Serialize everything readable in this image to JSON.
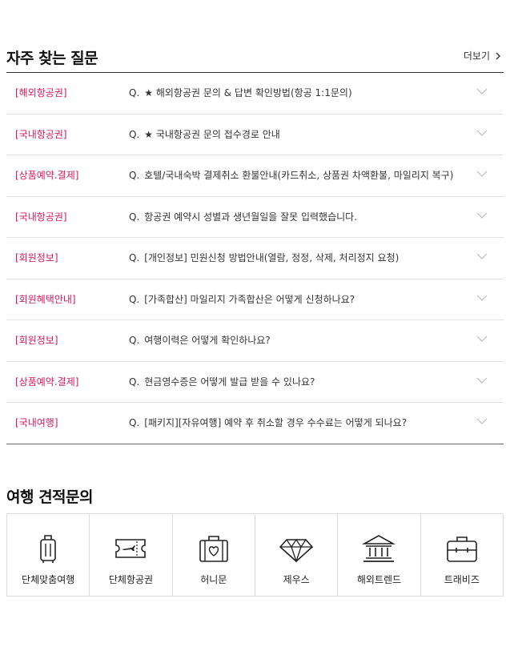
{
  "faq": {
    "title": "자주 찾는 질문",
    "more_label": "더보기",
    "q_prefix": "Q.",
    "items": [
      {
        "category": "[해외항공권]",
        "question": "★ 해외항공권 문의 & 답변 확인방법(항공 1:1문의)"
      },
      {
        "category": "[국내항공권]",
        "question": "★ 국내항공권 문의 접수경로 안내"
      },
      {
        "category": "[상품예약.결제]",
        "question": "호텔/국내숙박 결제취소 환불안내(카드취소, 상품권 차액환불, 마일리지 복구)"
      },
      {
        "category": "[국내항공권]",
        "question": "항공권 예약시 성별과 생년월일을 잘못 입력했습니다."
      },
      {
        "category": "[회원정보]",
        "question": "[개인정보] 민원신청 방법안내(열람, 정정, 삭제, 처리정지 요청)"
      },
      {
        "category": "[회원혜택안내]",
        "question": "[가족합산] 마일리지 가족합산은 어떻게 신청하나요?"
      },
      {
        "category": "[회원정보]",
        "question": "여행이력은 어떻게 확인하나요?"
      },
      {
        "category": "[상품예약.결제]",
        "question": "현금영수증은 어떻게 발급 받을 수 있나요?"
      },
      {
        "category": "[국내여행]",
        "question": "[패키지][자유여행] 예약 후 취소할 경우 수수료는 어떻게 되나요?"
      }
    ]
  },
  "quote": {
    "title": "여행 견적문의",
    "items": [
      {
        "label": "단체맞춤여행",
        "icon": "luggage-icon"
      },
      {
        "label": "단체항공권",
        "icon": "flight-ticket-icon"
      },
      {
        "label": "허니문",
        "icon": "heart-suitcase-icon"
      },
      {
        "label": "제우스",
        "icon": "diamond-icon"
      },
      {
        "label": "해외트렌드",
        "icon": "museum-icon"
      },
      {
        "label": "트래비즈",
        "icon": "briefcase-icon"
      }
    ]
  },
  "colors": {
    "category": "#d2195b",
    "text": "#333333",
    "border": "#dcdcdc"
  }
}
